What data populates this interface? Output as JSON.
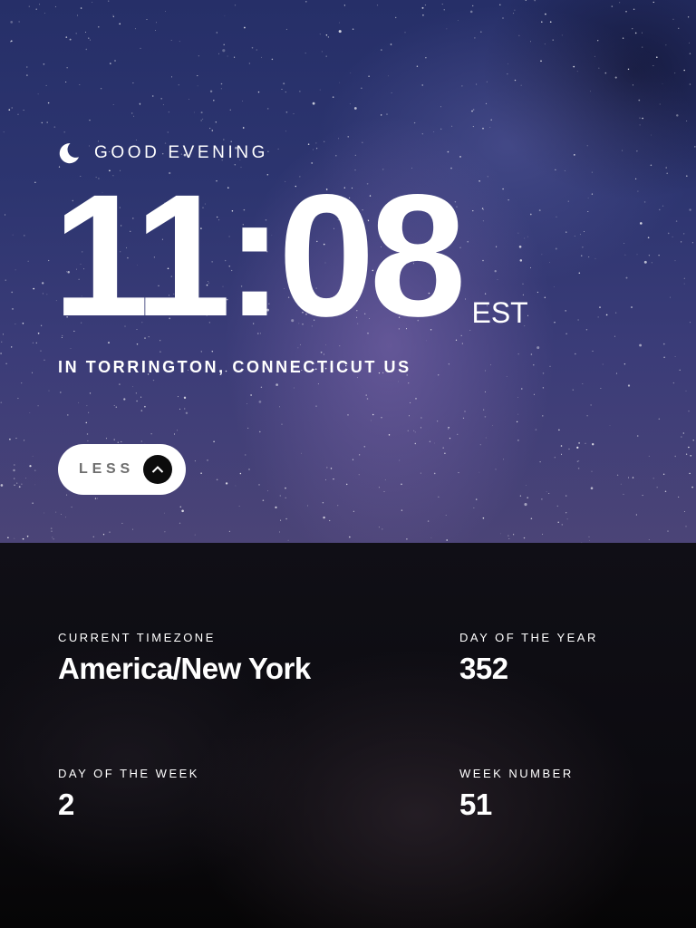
{
  "hero": {
    "greeting": "GOOD EVENING",
    "greeting_icon": "moon-icon",
    "time": "11:08",
    "timezone_abbr": "EST",
    "location": "IN TORRINGTON, CONNECTICUT US",
    "toggle_label": "LESS",
    "toggle_icon": "chevron-up-icon"
  },
  "details": {
    "current_timezone": {
      "label": "CURRENT TIMEZONE",
      "value": "America/New York"
    },
    "day_of_year": {
      "label": "DAY OF THE YEAR",
      "value": "352"
    },
    "day_of_week": {
      "label": "DAY OF THE WEEK",
      "value": "2"
    },
    "week_number": {
      "label": "WEEK NUMBER",
      "value": "51"
    }
  },
  "colors": {
    "text": "#ffffff",
    "button_bg": "#ffffff",
    "button_text": "#6e6e6e",
    "chevron_bg": "#0c0c0c",
    "panel_bg": "#0c0b10"
  }
}
